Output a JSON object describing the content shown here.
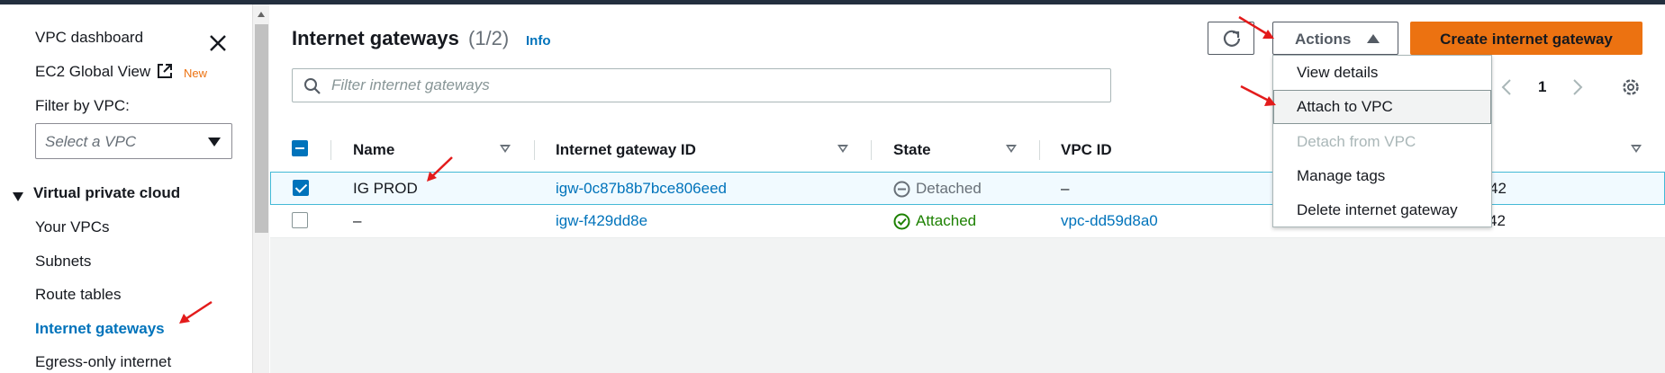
{
  "sidebar": {
    "vpc_dashboard": "VPC dashboard",
    "ec2_global_view": "EC2 Global View",
    "new_badge": "New",
    "filter_label": "Filter by VPC:",
    "vpc_select_placeholder": "Select a VPC",
    "section_title": "Virtual private cloud",
    "items": [
      {
        "label": "Your VPCs"
      },
      {
        "label": "Subnets"
      },
      {
        "label": "Route tables"
      },
      {
        "label": "Internet gateways",
        "active": true
      },
      {
        "label": "Egress-only internet"
      }
    ]
  },
  "header": {
    "title": "Internet gateways",
    "count": "(1/2)",
    "info": "Info"
  },
  "toolbar": {
    "actions_label": "Actions",
    "create_label": "Create internet gateway"
  },
  "filter": {
    "placeholder": "Filter internet gateways"
  },
  "pagination": {
    "page": "1"
  },
  "table": {
    "columns": [
      "Name",
      "Internet gateway ID",
      "State",
      "VPC ID"
    ],
    "rows": [
      {
        "selected": true,
        "name": "IG PROD",
        "gateway_id": "igw-0c87b8b7bce806eed",
        "state": "Detached",
        "vpc_id": "–",
        "owner_tail": "42"
      },
      {
        "selected": false,
        "name": "–",
        "gateway_id": "igw-f429dd8e",
        "state": "Attached",
        "vpc_id": "vpc-dd59d8a0",
        "owner_tail": "42"
      }
    ]
  },
  "actions_menu": {
    "items": [
      {
        "label": "View details",
        "disabled": false
      },
      {
        "label": "Attach to VPC",
        "disabled": false,
        "highlighted": true
      },
      {
        "label": "Detach from VPC",
        "disabled": true
      },
      {
        "label": "Manage tags",
        "disabled": false
      },
      {
        "label": "Delete internet gateway",
        "disabled": false
      }
    ]
  },
  "colors": {
    "link": "#0073bb",
    "primary_button": "#ec7211",
    "attached": "#1d8102",
    "detached": "#687078",
    "annotation_arrow": "#e31b1b"
  }
}
